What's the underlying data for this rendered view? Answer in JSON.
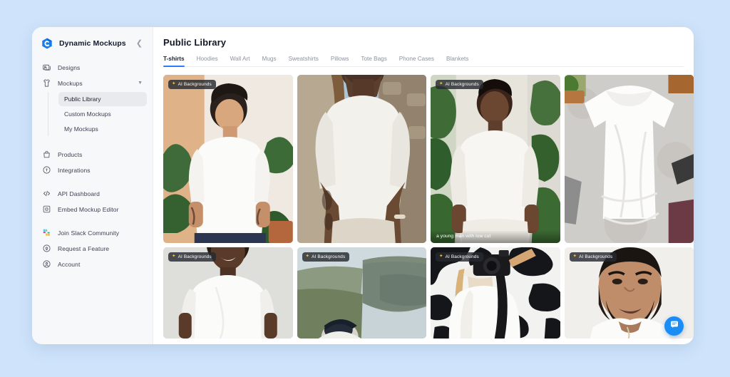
{
  "theme": {
    "page_background": "#cfe4fb",
    "card_background": "#ffffff",
    "sidebar_background": "#f7f8fa",
    "accent": "#2f7df6",
    "badge_background": "rgba(38,41,48,0.82)",
    "badge_spark_color": "#f6c343",
    "chat_button_color": "#1a8cf5",
    "active_subnav_background": "#e8eaee"
  },
  "sidebar": {
    "brand": {
      "name": "Dynamic Mockups",
      "logo_icon": "dynamic-mockups-logo",
      "collapse_icon": "chevron-left-icon"
    },
    "items": [
      {
        "label": "Designs",
        "icon": "image-stack-icon",
        "active": false
      },
      {
        "label": "Mockups",
        "icon": "tshirt-icon",
        "active": false,
        "expanded": true,
        "chevron": "chevron-down-icon"
      }
    ],
    "sub_items": [
      {
        "label": "Public Library",
        "active": true
      },
      {
        "label": "Custom Mockups",
        "active": false
      },
      {
        "label": "My Mockups",
        "active": false
      }
    ],
    "group2": [
      {
        "label": "Products",
        "icon": "bag-icon"
      },
      {
        "label": "Integrations",
        "icon": "plug-icon"
      }
    ],
    "group3": [
      {
        "label": "API Dashboard",
        "icon": "code-icon"
      },
      {
        "label": "Embed Mockup Editor",
        "icon": "embed-frame-icon"
      }
    ],
    "group4": [
      {
        "label": "Join Slack Community",
        "icon": "slack-icon"
      },
      {
        "label": "Request a Feature",
        "icon": "lightbulb-icon"
      },
      {
        "label": "Account",
        "icon": "user-circle-icon"
      }
    ]
  },
  "main": {
    "page_title": "Public Library",
    "tabs": [
      {
        "label": "T-shirts",
        "active": true
      },
      {
        "label": "Hoodies",
        "active": false
      },
      {
        "label": "Wall Art",
        "active": false
      },
      {
        "label": "Mugs",
        "active": false
      },
      {
        "label": "Sweatshirts",
        "active": false
      },
      {
        "label": "Pillows",
        "active": false
      },
      {
        "label": "Tote Bags",
        "active": false
      },
      {
        "label": "Phone Cases",
        "active": false
      },
      {
        "label": "Blankets",
        "active": false
      }
    ],
    "badge_label": "AI Backgrounds",
    "badge_icon": "sparkle-icon",
    "gallery": {
      "row1": [
        {
          "alt": "young man in white tee standing by plants",
          "badge": true,
          "caption": ""
        },
        {
          "alt": "man in white oversized tee by ocean patio",
          "badge": false,
          "caption": ""
        },
        {
          "alt": "man in white tee in plant filled room",
          "badge": true,
          "caption": "a young man with low cut"
        },
        {
          "alt": "white t-shirt flat lay on concrete",
          "badge": false,
          "caption": ""
        }
      ],
      "row2": [
        {
          "alt": "smiling man in white tee on grey backdrop",
          "badge": true,
          "caption": ""
        },
        {
          "alt": "person in white tee on mountain cliff",
          "badge": true,
          "caption": ""
        },
        {
          "alt": "woman with camera in white tee cow print backdrop",
          "badge": true,
          "caption": ""
        },
        {
          "alt": "bearded man in white tee studio portrait",
          "badge": true,
          "caption": ""
        }
      ]
    }
  },
  "chat": {
    "icon": "chat-bubble-icon",
    "label": "Open chat"
  }
}
